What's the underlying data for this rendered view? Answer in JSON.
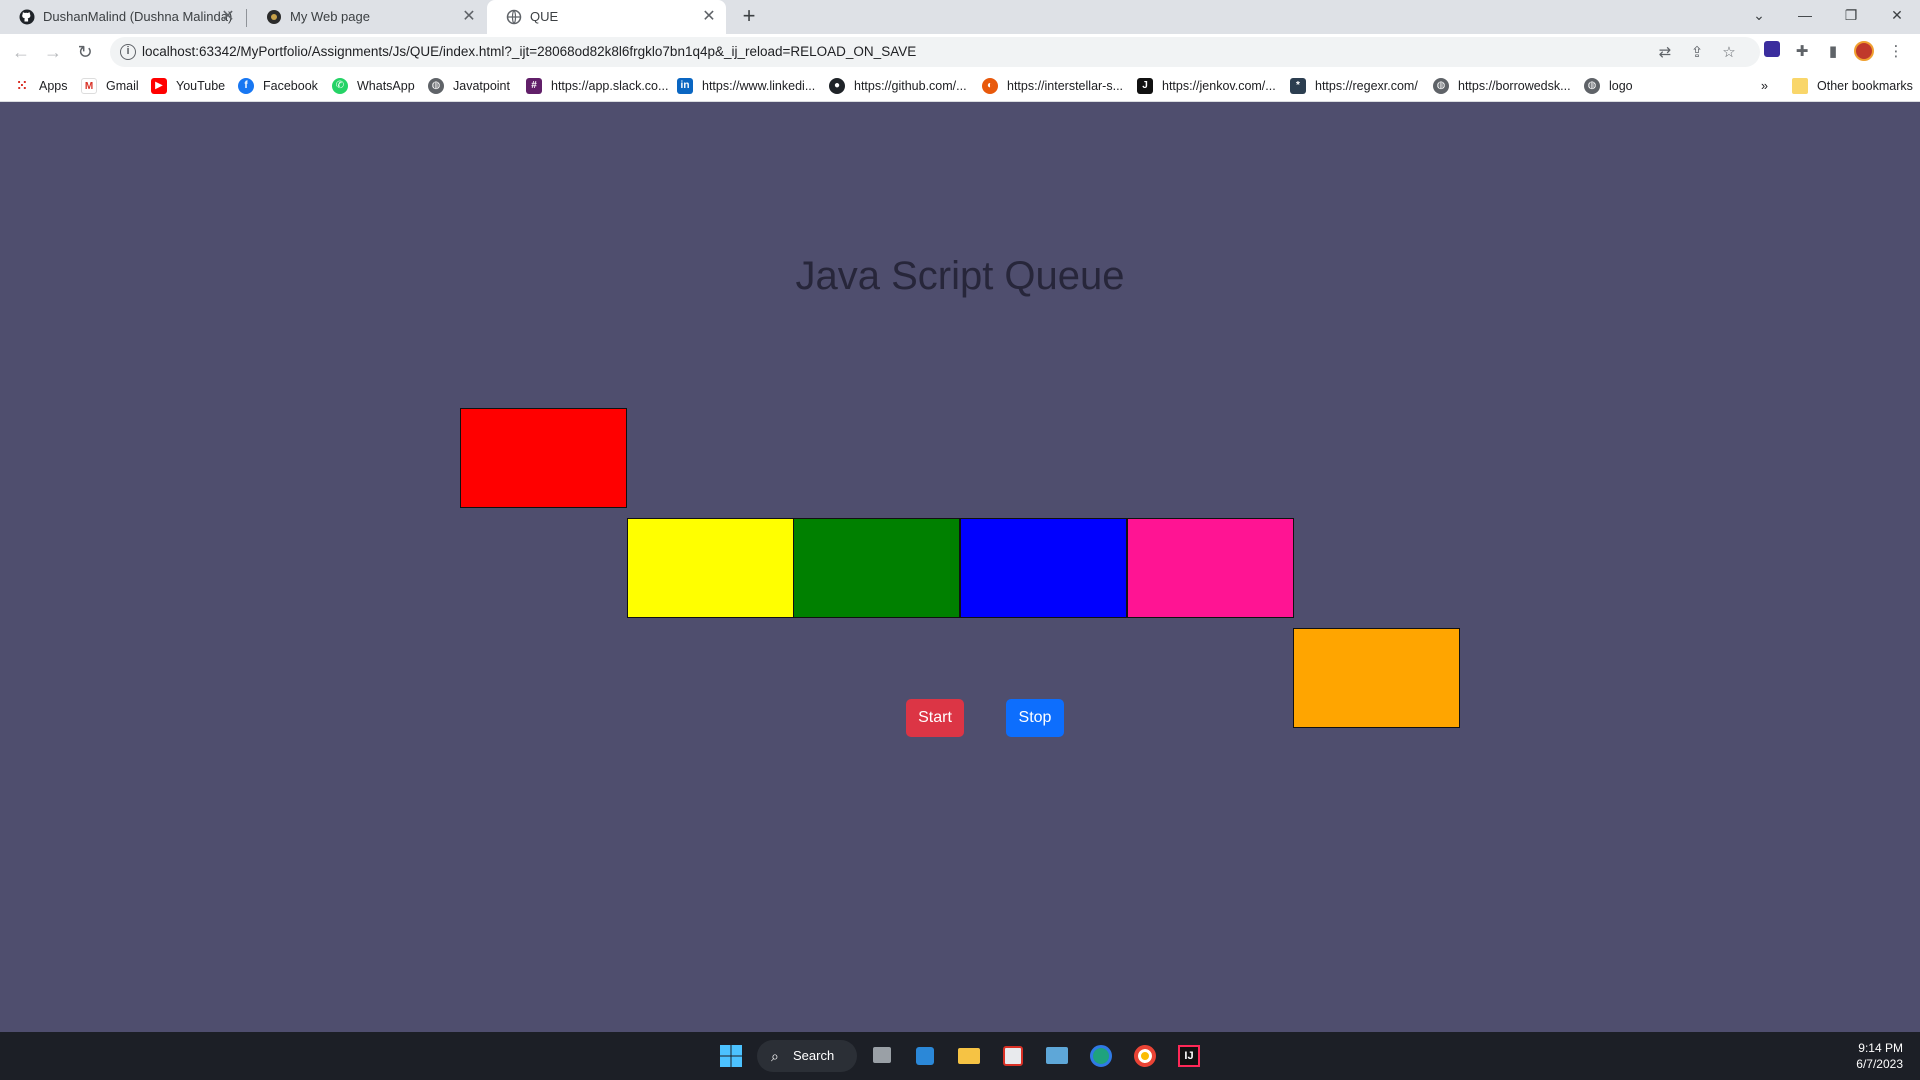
{
  "browser": {
    "tabs": [
      {
        "title": "DushanMalind (Dushna Malinda)",
        "icon": "github-icon"
      },
      {
        "title": "My Web page",
        "icon": "site-icon"
      },
      {
        "title": "QUE",
        "icon": "globe-icon",
        "active": true
      }
    ],
    "url": {
      "host": "localhost",
      "path": ":63342/MyPortfolio/Assignments/Js/QUE/index.html?_ijt=28068od82k8l6frgklo7bn1q4p&_ij_reload=RELOAD_ON_SAVE"
    },
    "bookmarks": [
      {
        "label": "Apps",
        "icon": "apps-grid-icon"
      },
      {
        "label": "Gmail",
        "icon": "gmail-icon"
      },
      {
        "label": "YouTube",
        "icon": "youtube-icon"
      },
      {
        "label": "Facebook",
        "icon": "facebook-icon"
      },
      {
        "label": "WhatsApp",
        "icon": "whatsapp-icon"
      },
      {
        "label": "Javatpoint",
        "icon": "globe-icon"
      },
      {
        "label": "https://app.slack.co...",
        "icon": "slack-icon"
      },
      {
        "label": "https://www.linkedi...",
        "icon": "linkedin-icon"
      },
      {
        "label": "https://github.com/...",
        "icon": "github-icon"
      },
      {
        "label": "https://interstellar-s...",
        "icon": "interstellar-icon"
      },
      {
        "label": "https://jenkov.com/...",
        "icon": "jenkov-icon"
      },
      {
        "label": "https://regexr.com/",
        "icon": "regexr-icon"
      },
      {
        "label": "https://borrowedsk...",
        "icon": "globe-icon"
      },
      {
        "label": "logo",
        "icon": "globe-icon"
      }
    ],
    "other_bookmarks": "Other bookmarks",
    "overflow": "»"
  },
  "page": {
    "title": "Java Script Queue",
    "boxes": [
      {
        "color": "#ff0000"
      },
      {
        "color": "#ffff00"
      },
      {
        "color": "#008000"
      },
      {
        "color": "#0000ff"
      },
      {
        "color": "#ff1493"
      },
      {
        "color": "#ffa500"
      }
    ],
    "start_label": "Start",
    "stop_label": "Stop"
  },
  "taskbar": {
    "search_label": "Search",
    "time": "9:14 PM",
    "date": "6/7/2023"
  }
}
